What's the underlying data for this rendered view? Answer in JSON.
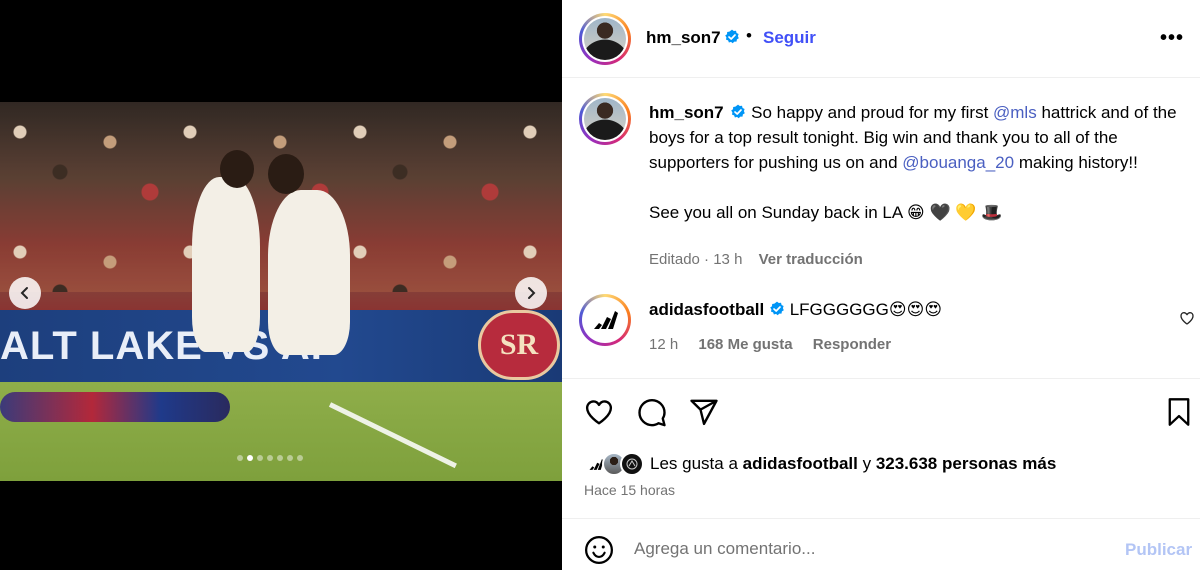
{
  "media": {
    "banner_text": "ALT LAKE VS AF",
    "logo_text": "SR",
    "carousel": {
      "total": 7,
      "active": 2
    }
  },
  "post": {
    "header": {
      "username": "hm_son7",
      "bullet": "•",
      "follow_label": "Seguir",
      "more_label": "•••"
    },
    "caption": {
      "username": "hm_son7",
      "part1": "So happy and proud for my first ",
      "mention1": "@mls",
      "part2": " hattrick and of the boys for a top result tonight. Big win and thank you to all of the supporters for pushing us on and ",
      "mention2": "@bouanga_20",
      "part3": " making history!!",
      "line2": "See you all on Sunday back in LA 😁 🖤 💛 🎩",
      "edited": "Editado",
      "age": "13 h",
      "translate": "Ver traducción"
    },
    "comment": {
      "username": "adidasfootball",
      "text": "LFGGGGGG😍😍😍",
      "age": "12 h",
      "likes": "168 Me gusta",
      "reply": "Responder"
    },
    "likes": {
      "prefix": "Les gusta a ",
      "user": "adidasfootball",
      "middle": " y ",
      "count": "323.638 personas más"
    },
    "time_ago": "Hace 15 horas",
    "add_comment": {
      "placeholder": "Agrega un comentario...",
      "publish_label": "Publicar"
    }
  },
  "colors": {
    "accent": "#4150f7",
    "publish_disabled": "#b3c5f5",
    "mention": "#4a5fc1",
    "secondary_text": "#737373",
    "verified": "#0095f6"
  }
}
